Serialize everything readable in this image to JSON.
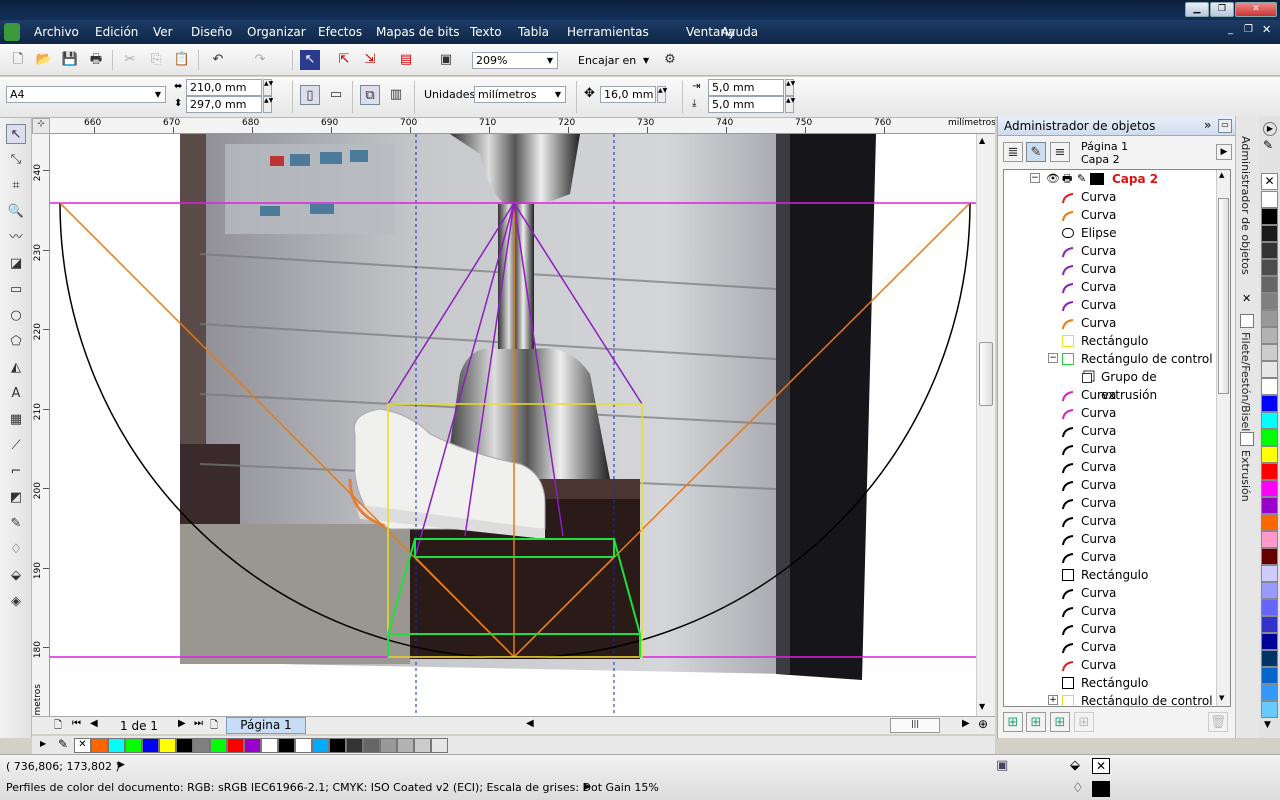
{
  "app": {
    "menus": [
      "Archivo",
      "Edición",
      "Ver",
      "Diseño",
      "Organizar",
      "Efectos",
      "Mapas de bits",
      "Texto",
      "Tabla",
      "Herramientas",
      "Ventana",
      "Ayuda"
    ]
  },
  "toolbar": {
    "zoom": "209%",
    "snap_label": "Encajar en"
  },
  "propbar": {
    "page_size": "A4",
    "width": "210,0 mm",
    "height": "297,0 mm",
    "units_label": "Unidades:",
    "units": "milímetros",
    "nudge": "16,0 mm",
    "dup_x": "5,0 mm",
    "dup_y": "5,0 mm"
  },
  "rulers": {
    "h_ticks": [
      "660",
      "670",
      "680",
      "690",
      "700",
      "710",
      "720",
      "730",
      "740",
      "750",
      "760"
    ],
    "h_unit": "milímetros",
    "v_ticks": [
      "240",
      "230",
      "220",
      "210",
      "200",
      "190",
      "180"
    ],
    "v_unit": "milímetros"
  },
  "pagenav": {
    "counter": "1 de 1",
    "tab": "Página 1"
  },
  "status": {
    "coords": "( 736,806; 173,802 )",
    "color_profiles": "Perfiles de color del documento: RGB: sRGB IEC61966-2.1; CMYK: ISO Coated v2 (ECI); Escala de grises: Dot Gain 15%"
  },
  "objmgr": {
    "title": "Administrador de objetos",
    "page": "Página 1",
    "layer": "Capa 2",
    "layer_name": "Capa 2",
    "items": [
      {
        "label": "Curva",
        "icon": "curve-red-icon",
        "color": "#e02020",
        "indent": 0
      },
      {
        "label": "Curva",
        "icon": "curve-orange-icon",
        "color": "#e87a10",
        "indent": 0
      },
      {
        "label": "Elipse",
        "icon": "ellipse-icon",
        "color": "#000000",
        "indent": 0
      },
      {
        "label": "Curva",
        "icon": "curve-purple-icon",
        "color": "#8a20c0",
        "indent": 0
      },
      {
        "label": "Curva",
        "icon": "curve-purple-icon",
        "color": "#8a20c0",
        "indent": 0
      },
      {
        "label": "Curva",
        "icon": "curve-purple-icon",
        "color": "#8a20c0",
        "indent": 0
      },
      {
        "label": "Curva",
        "icon": "curve-purple-icon",
        "color": "#8a20c0",
        "indent": 0
      },
      {
        "label": "Curva",
        "icon": "curve-orange-icon",
        "color": "#e87a10",
        "indent": 0
      },
      {
        "label": "Rectángulo",
        "icon": "rectangle-yellow-icon",
        "color": "#e8e020",
        "indent": 0
      },
      {
        "label": "Rectángulo de control",
        "icon": "rectangle-green-icon",
        "color": "#20d040",
        "indent": 0,
        "expand": "−"
      },
      {
        "label": "Grupo de extrusión",
        "icon": "extrusion-group-icon",
        "color": "#000000",
        "indent": 1
      },
      {
        "label": "Curva",
        "icon": "curve-magenta-icon",
        "color": "#e020c0",
        "indent": 0
      },
      {
        "label": "Curva",
        "icon": "curve-magenta-icon",
        "color": "#e020c0",
        "indent": 0
      },
      {
        "label": "Curva",
        "icon": "curve-black-icon",
        "color": "#000000",
        "indent": 0
      },
      {
        "label": "Curva",
        "icon": "curve-black-icon",
        "color": "#000000",
        "indent": 0
      },
      {
        "label": "Curva",
        "icon": "curve-black-icon",
        "color": "#000000",
        "indent": 0
      },
      {
        "label": "Curva",
        "icon": "curve-black-icon",
        "color": "#000000",
        "indent": 0
      },
      {
        "label": "Curva",
        "icon": "curve-black-icon",
        "color": "#000000",
        "indent": 0
      },
      {
        "label": "Curva",
        "icon": "curve-black-icon",
        "color": "#000000",
        "indent": 0
      },
      {
        "label": "Curva",
        "icon": "curve-black-icon",
        "color": "#000000",
        "indent": 0
      },
      {
        "label": "Curva",
        "icon": "curve-black-icon",
        "color": "#000000",
        "indent": 0
      },
      {
        "label": "Rectángulo",
        "icon": "rectangle-black-icon",
        "color": "#000000",
        "indent": 0
      },
      {
        "label": "Curva",
        "icon": "curve-black-icon",
        "color": "#000000",
        "indent": 0
      },
      {
        "label": "Curva",
        "icon": "curve-black-icon",
        "color": "#000000",
        "indent": 0
      },
      {
        "label": "Curva",
        "icon": "curve-black-icon",
        "color": "#000000",
        "indent": 0
      },
      {
        "label": "Curva",
        "icon": "curve-black-icon",
        "color": "#000000",
        "indent": 0
      },
      {
        "label": "Curva",
        "icon": "curve-red-icon",
        "color": "#e02020",
        "indent": 0
      },
      {
        "label": "Rectángulo",
        "icon": "rectangle-black-icon",
        "color": "#000000",
        "indent": 0
      },
      {
        "label": "Rectángulo de control",
        "icon": "rectangle-yellow-icon",
        "color": "#e8e020",
        "indent": 0,
        "expand": "+"
      }
    ]
  },
  "dockers": {
    "tab1": "Administrador de objetos",
    "tab2": "Filete/Festón/Bisel",
    "tab3": "Extrusión"
  },
  "palette": {
    "colors": [
      "#ffffff",
      "#000000",
      "#1a1a1a",
      "#333333",
      "#4d4d4d",
      "#666666",
      "#808080",
      "#999999",
      "#b3b3b3",
      "#cccccc",
      "#e6e6e6",
      "#ffffff",
      "#0000ff",
      "#00ffff",
      "#00ff00",
      "#ffff00",
      "#ff0000",
      "#ff00ff",
      "#9900cc",
      "#ff6600",
      "#ff99cc",
      "#660000",
      "#ccccff",
      "#9999ff",
      "#6666ff",
      "#3333cc",
      "#000099",
      "#003366",
      "#0066cc",
      "#3399ff",
      "#66ccff"
    ]
  },
  "docpalette": {
    "colors": [
      "#ff6600",
      "#00ffff",
      "#00ff00",
      "#0000ff",
      "#ffff00",
      "#000000",
      "#808080",
      "#00ff00",
      "#ff0000",
      "#9900cc",
      "#ffffff",
      "#000000",
      "#ffffff",
      "#00aaff",
      "#000000",
      "#333333",
      "#666666",
      "#999999",
      "#b3b3b3",
      "#cccccc",
      "#e6e6e6"
    ]
  }
}
